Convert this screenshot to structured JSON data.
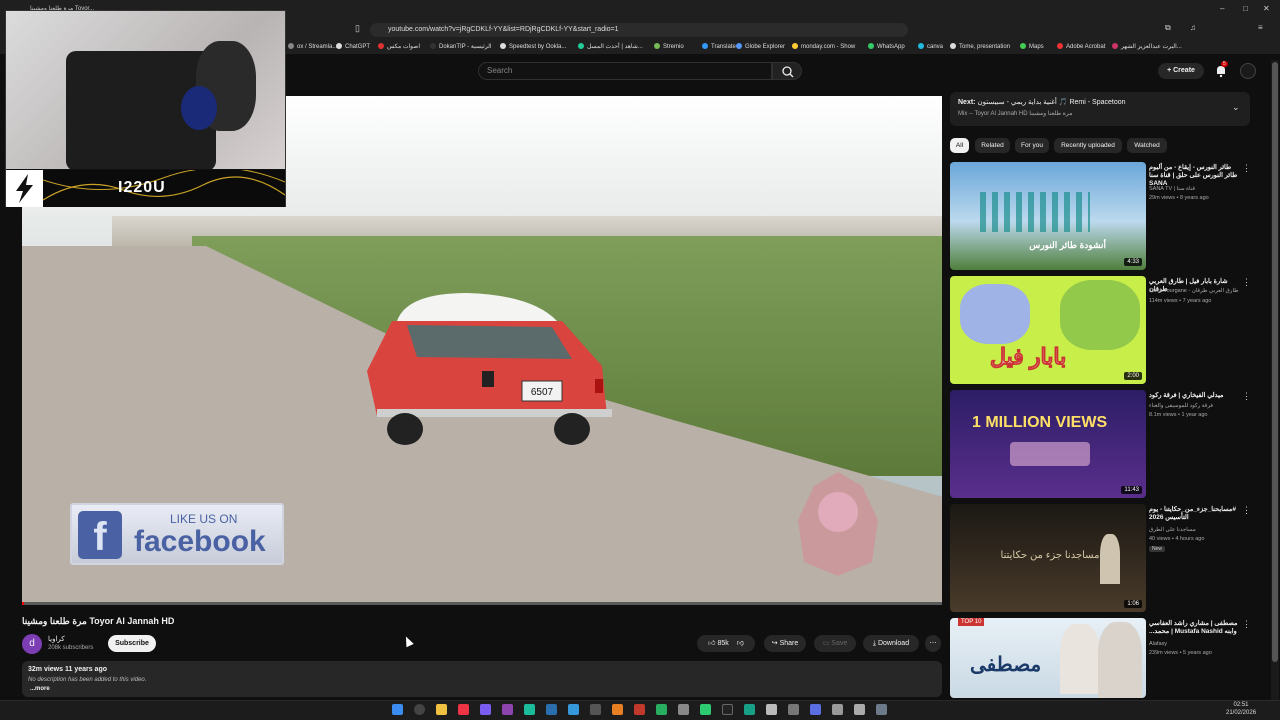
{
  "browser": {
    "tab_title": "مرة طلعنا ومشينا Toyor...",
    "url": "youtube.com/watch?v=jRgCDKLf-YY&list=RDjRgCDKLf-YY&start_radio=1",
    "bookmarks": [
      {
        "label": "ox / Streamla...",
        "color": "#888"
      },
      {
        "label": "ChatGPT",
        "color": "#ddd"
      },
      {
        "label": "اصوات مكس",
        "color": "#d33"
      },
      {
        "label": "DokanTIP - الرئيسية",
        "color": "#333"
      },
      {
        "label": "Speedtest by Ookla...",
        "color": "#ddd"
      },
      {
        "label": "شاهد | أحدث المسل...",
        "color": "#2c9"
      },
      {
        "label": "Stremio",
        "color": "#7b5"
      },
      {
        "label": "Translate",
        "color": "#39f"
      },
      {
        "label": "Globe Explorer",
        "color": "#59f"
      },
      {
        "label": "monday.com - Show",
        "color": "#fc3"
      },
      {
        "label": "WhatsApp",
        "color": "#3c6"
      },
      {
        "label": "canva",
        "color": "#2bd"
      },
      {
        "label": "Tome, presentation",
        "color": "#ddd"
      },
      {
        "label": "Maps",
        "color": "#4c5"
      },
      {
        "label": "Adobe Acrobat",
        "color": "#e33"
      },
      {
        "label": "البرت عبدالعزيز الشهر...",
        "color": "#c36"
      }
    ]
  },
  "header": {
    "search_placeholder": "Search",
    "create_label": "Create",
    "notif_count": "5"
  },
  "webcam": {
    "streamer_name": "I220U"
  },
  "video": {
    "title": "مرة طلعنا ومشينا Toyor Al Jannah HD",
    "overlay_fb_small": "LIKE US ON",
    "overlay_fb_big": "facebook",
    "plate": "6507",
    "channel_name": "كراويا",
    "channel_initial": "d",
    "subscribers": "208k subscribers",
    "subscribe_label": "Subscribe",
    "likes": "85k",
    "share_label": "Share",
    "save_label": "Save",
    "download_label": "Download",
    "views_age": "32m views  11 years ago",
    "description": "No description has been added to this video.",
    "more_label": "...more",
    "progress": 0.002
  },
  "sidebar": {
    "next_label": "Next:",
    "next_title": "أغنية بداية ريمي - سبيستون 🎵 Remi - Spacetoon",
    "next_sub": "Mix -- Toyor Al Jannah HD مرة طلعنا ومشينا",
    "chips": [
      "All",
      "Related",
      "For you",
      "Recently uploaded",
      "Watched"
    ],
    "items": [
      {
        "title": "طائر النورس - إيقاع - من ألبوم طائر النورس على حلق | قناة سنا SANA",
        "channel": "SANA TV | قناة سنا",
        "meta": "29m views • 8 years ago",
        "duration": "4:33",
        "thumb_text": "أنشودة  طائر النورس"
      },
      {
        "title": "شارة بابار فيل | طارق العربي طرقان",
        "channel": "Tarek Tourgane - طارق العربي طرقان",
        "meta": "114m views • 7 years ago",
        "duration": "2:00",
        "thumb_text": "بابار فيل"
      },
      {
        "title": "ميدلي الفيخاري | فرقة ركود",
        "channel": "فرقة ركود للموسيقى والغناء",
        "meta": "8.1m views • 1 year ago",
        "duration": "11:43",
        "thumb_text": "1 MILLION VIEWS"
      },
      {
        "title": "#مسابحنا_جزء_من_حكايتنا - يوم التأسيس 2026",
        "channel": "مساجدنا على الطرق",
        "meta": "40 views • 4 hours ago",
        "duration": "1:06",
        "thumb_text": "مساجدنا جزء من حكايتنا",
        "badge": "New"
      },
      {
        "title": "مصطفى | مشاري راشد العفاسي وابنه Mustafa Nashid | محمد...",
        "channel": "Alafasy",
        "meta": "239m views • 5 years ago",
        "duration": "",
        "thumb_text": "مصطفى",
        "badge_top": "TOP 10"
      }
    ]
  },
  "taskbar": {
    "time": "02:51",
    "date": "21/02/2026"
  }
}
